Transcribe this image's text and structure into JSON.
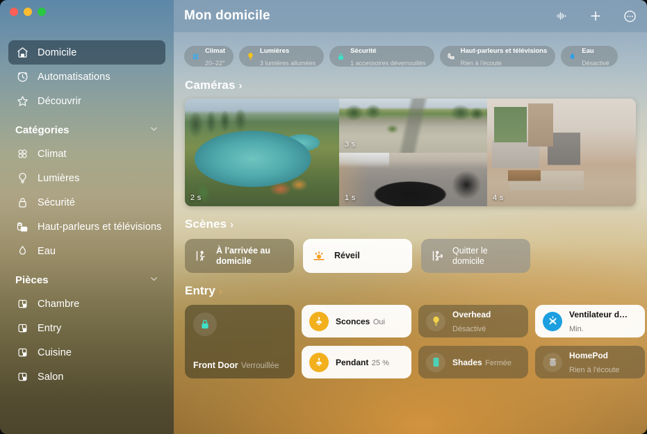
{
  "window": {
    "traffic_lights": [
      "close",
      "minimize",
      "zoom"
    ]
  },
  "sidebar": {
    "top_items": [
      {
        "label": "Domicile",
        "icon": "house-icon",
        "selected": true
      },
      {
        "label": "Automatisations",
        "icon": "clock-arrow-icon",
        "selected": false
      },
      {
        "label": "Découvrir",
        "icon": "star-icon",
        "selected": false
      }
    ],
    "categories": {
      "title": "Catégories",
      "chevron": "chevron-down-icon",
      "items": [
        {
          "label": "Climat",
          "icon": "fan-icon"
        },
        {
          "label": "Lumières",
          "icon": "lightbulb-icon"
        },
        {
          "label": "Sécurité",
          "icon": "lock-icon"
        },
        {
          "label": "Haut-parleurs et télévisions",
          "icon": "speaker-tv-icon"
        },
        {
          "label": "Eau",
          "icon": "water-drop-icon"
        }
      ]
    },
    "rooms": {
      "title": "Pièces",
      "chevron": "chevron-down-icon",
      "items": [
        {
          "label": "Chambre",
          "icon": "room-icon"
        },
        {
          "label": "Entry",
          "icon": "room-icon"
        },
        {
          "label": "Cuisine",
          "icon": "room-icon"
        },
        {
          "label": "Salon",
          "icon": "room-icon"
        }
      ]
    }
  },
  "header": {
    "title": "Mon domicile",
    "tools": [
      {
        "name": "audio-waveform-icon"
      },
      {
        "name": "add-icon"
      },
      {
        "name": "more-options-icon"
      }
    ]
  },
  "status_chips": [
    {
      "title": "Climat",
      "subtitle": "20–22°",
      "icon": "fan-icon",
      "color": "#4aa8e0"
    },
    {
      "title": "Lumières",
      "subtitle": "3 lumières allumées",
      "icon": "lightbulb-icon",
      "color": "#f5c518"
    },
    {
      "title": "Sécurité",
      "subtitle": "1 accessoires déverrouillés",
      "icon": "lock-icon",
      "color": "#3fe0c8"
    },
    {
      "title": "Haut-parleurs et télévisions",
      "subtitle": "Rien à l'écoute",
      "icon": "speaker-tv-icon",
      "color": "#d9d9d9"
    },
    {
      "title": "Eau",
      "subtitle": "Désactivé",
      "icon": "water-drop-icon",
      "color": "#2f9fe8"
    }
  ],
  "sections": {
    "cameras": {
      "title": "Caméras",
      "arrow": "›"
    },
    "scenes": {
      "title": "Scènes",
      "arrow": "›"
    },
    "entry": {
      "title": "Entry",
      "arrow": "›"
    }
  },
  "cameras": [
    {
      "name": "pool-camera",
      "tag": "2 s",
      "scene": "scene-pool"
    },
    {
      "name": "driveway-camera",
      "tag": "3 s",
      "scene": "scene-drive"
    },
    {
      "name": "garage-camera",
      "tag": "1 s",
      "scene": "scene-garage"
    },
    {
      "name": "living-room-camera",
      "tag": "4 s",
      "scene": "scene-living"
    }
  ],
  "scenes": [
    {
      "label": "À l'arrivée au domicile",
      "icon": "person-arrive-icon",
      "style": "dim"
    },
    {
      "label": "Réveil",
      "icon": "sunrise-icon",
      "style": "active"
    },
    {
      "label": "Quitter le domicile",
      "icon": "person-leave-icon",
      "style": "grey"
    }
  ],
  "accessories": [
    {
      "name": "Front Door",
      "status": "Verrouillée",
      "icon": "lock-icon",
      "state": "off",
      "size": "large",
      "accent": "#3fe0c8"
    },
    {
      "name": "Sconces",
      "status": "Oui",
      "icon": "sconce-light-icon",
      "state": "on",
      "accent": "#f2b01e"
    },
    {
      "name": "Pendant",
      "status": "25 %",
      "icon": "pendant-light-icon",
      "state": "on",
      "accent": "#f2b01e"
    },
    {
      "name": "Overhead",
      "status": "Désactivé",
      "icon": "lightbulb-icon",
      "state": "off",
      "accent": "#f2d24a"
    },
    {
      "name": "Shades",
      "status": "Fermée",
      "icon": "shades-icon",
      "state": "off",
      "accent": "#3fe0c8"
    },
    {
      "name": "Ventilateur d…",
      "status": "Min.",
      "icon": "ceiling-fan-icon",
      "state": "on",
      "accent": "#1b9fe0"
    },
    {
      "name": "HomePod",
      "status": "Rien à l'écoute",
      "icon": "homepod-icon",
      "state": "off",
      "accent": "#b9b4ab"
    }
  ]
}
